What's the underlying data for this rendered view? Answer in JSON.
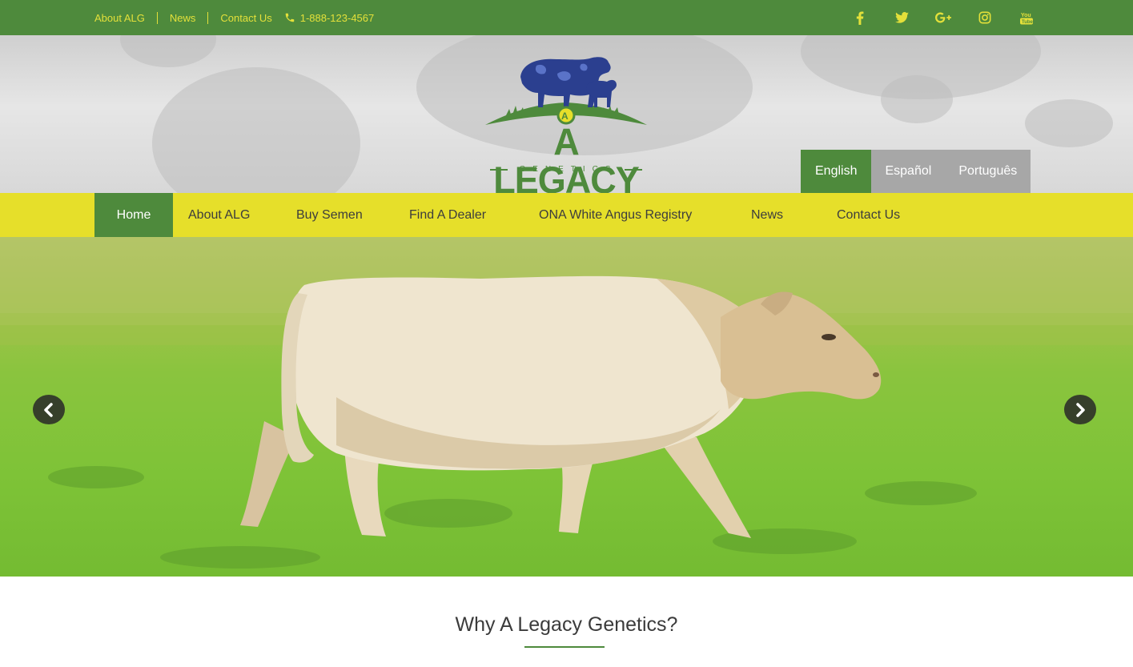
{
  "topbar": {
    "links": [
      "About ALG",
      "News",
      "Contact Us"
    ],
    "phone": "1-888-123-4567",
    "social_icons": [
      "facebook-icon",
      "twitter-icon",
      "google-plus-icon",
      "instagram-icon",
      "youtube-icon"
    ]
  },
  "logo": {
    "name": "A LEGACY",
    "sub": "GENETICS"
  },
  "languages": {
    "active": "English",
    "others": [
      "Español",
      "Português"
    ]
  },
  "nav": {
    "items": [
      "Home",
      "About ALG",
      "Buy Semen",
      "Find A Dealer",
      "ONA White Angus Registry",
      "News",
      "Contact Us"
    ],
    "active": "Home"
  },
  "hero": {
    "prev_icon": "chevron-left-icon",
    "next_icon": "chevron-right-icon"
  },
  "section": {
    "title": "Why A Legacy Genetics?"
  },
  "colors": {
    "brand_green": "#4e8a3c",
    "accent_yellow": "#e6df2a",
    "link_yellow": "#e3e03a",
    "logo_blue": "#2b3f8f"
  }
}
